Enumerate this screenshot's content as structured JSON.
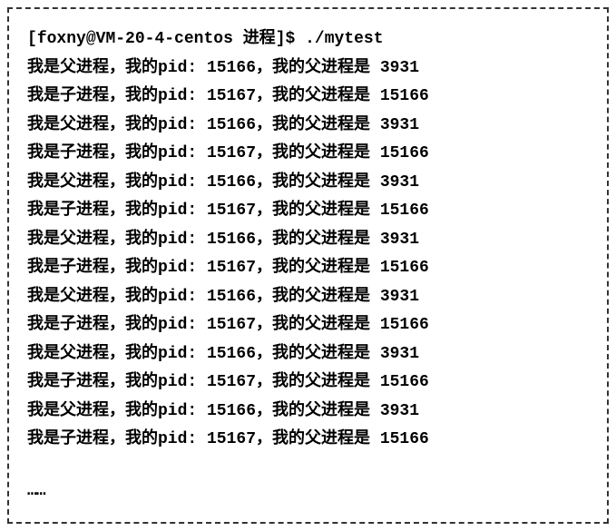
{
  "prompt": {
    "user": "foxny",
    "host": "VM-20-4-centos",
    "dir": "进程",
    "symbol": "$",
    "command": "./mytest"
  },
  "output_lines": [
    {
      "type": "父",
      "pid": "15166",
      "ppid": "3931"
    },
    {
      "type": "子",
      "pid": "15167",
      "ppid": "15166"
    },
    {
      "type": "父",
      "pid": "15166",
      "ppid": "3931"
    },
    {
      "type": "子",
      "pid": "15167",
      "ppid": "15166"
    },
    {
      "type": "父",
      "pid": "15166",
      "ppid": "3931"
    },
    {
      "type": "子",
      "pid": "15167",
      "ppid": "15166"
    },
    {
      "type": "父",
      "pid": "15166",
      "ppid": "3931"
    },
    {
      "type": "子",
      "pid": "15167",
      "ppid": "15166"
    },
    {
      "type": "父",
      "pid": "15166",
      "ppid": "3931"
    },
    {
      "type": "子",
      "pid": "15167",
      "ppid": "15166"
    },
    {
      "type": "父",
      "pid": "15166",
      "ppid": "3931"
    },
    {
      "type": "子",
      "pid": "15167",
      "ppid": "15166"
    },
    {
      "type": "父",
      "pid": "15166",
      "ppid": "3931"
    },
    {
      "type": "子",
      "pid": "15167",
      "ppid": "15166"
    }
  ],
  "labels": {
    "prefix": "我是",
    "suffix_type": "进程，我的pid:",
    "parent_label": "，我的父进程是"
  },
  "ellipsis": "……"
}
